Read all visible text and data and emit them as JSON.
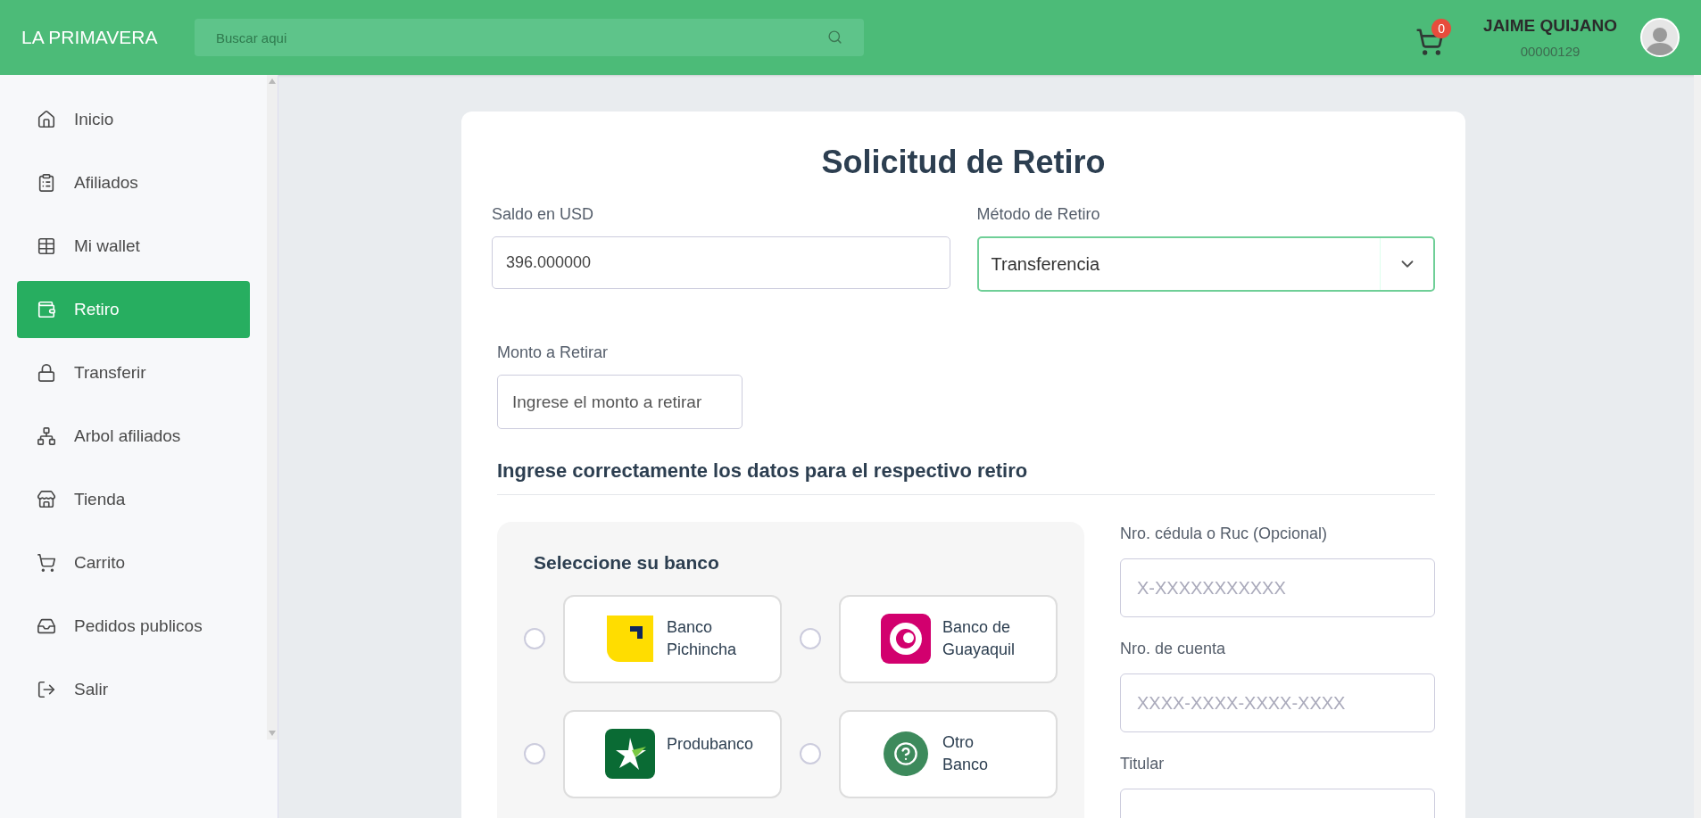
{
  "header": {
    "brand": "LA PRIMAVERA",
    "search": {
      "placeholder": "Buscar aqui"
    },
    "cart_count": "0",
    "user": {
      "name": "JAIME QUIJANO",
      "code": "00000129"
    }
  },
  "sidebar": {
    "items": [
      {
        "label": "Inicio",
        "selected": false
      },
      {
        "label": "Afiliados",
        "selected": false
      },
      {
        "label": "Mi wallet",
        "selected": false
      },
      {
        "label": "Retiro",
        "selected": true
      },
      {
        "label": "Transferir",
        "selected": false
      },
      {
        "label": "Arbol afiliados",
        "selected": false
      },
      {
        "label": "Tienda",
        "selected": false
      },
      {
        "label": "Carrito",
        "selected": false
      },
      {
        "label": "Pedidos publicos",
        "selected": false
      },
      {
        "label": "Salir",
        "selected": false
      }
    ]
  },
  "form": {
    "title": "Solicitud de Retiro",
    "balance": {
      "label": "Saldo en USD",
      "value": "396.000000"
    },
    "method": {
      "label": "Método de Retiro",
      "value": "Transferencia"
    },
    "amount": {
      "label": "Monto a Retirar",
      "placeholder": "Ingrese el monto a retirar"
    },
    "section_title": "Ingrese correctamente los datos para el respectivo retiro",
    "bank_panel": {
      "title": "Seleccione su banco",
      "banks": [
        {
          "name": [
            "Banco",
            "Pichincha"
          ],
          "selected": false
        },
        {
          "name": [
            "Banco de",
            "Guayaquil"
          ],
          "selected": false
        },
        {
          "name": [
            "Produbanco"
          ],
          "selected": false
        },
        {
          "name": [
            "Otro",
            "Banco"
          ],
          "selected": false
        }
      ]
    },
    "fields": [
      {
        "label": "Nro. cédula o Ruc (Opcional)",
        "placeholder": "X-XXXXXXXXXXX"
      },
      {
        "label": "Nro. de cuenta",
        "placeholder": "XXXX-XXXX-XXXX-XXXX"
      },
      {
        "label": "Titular"
      }
    ]
  }
}
